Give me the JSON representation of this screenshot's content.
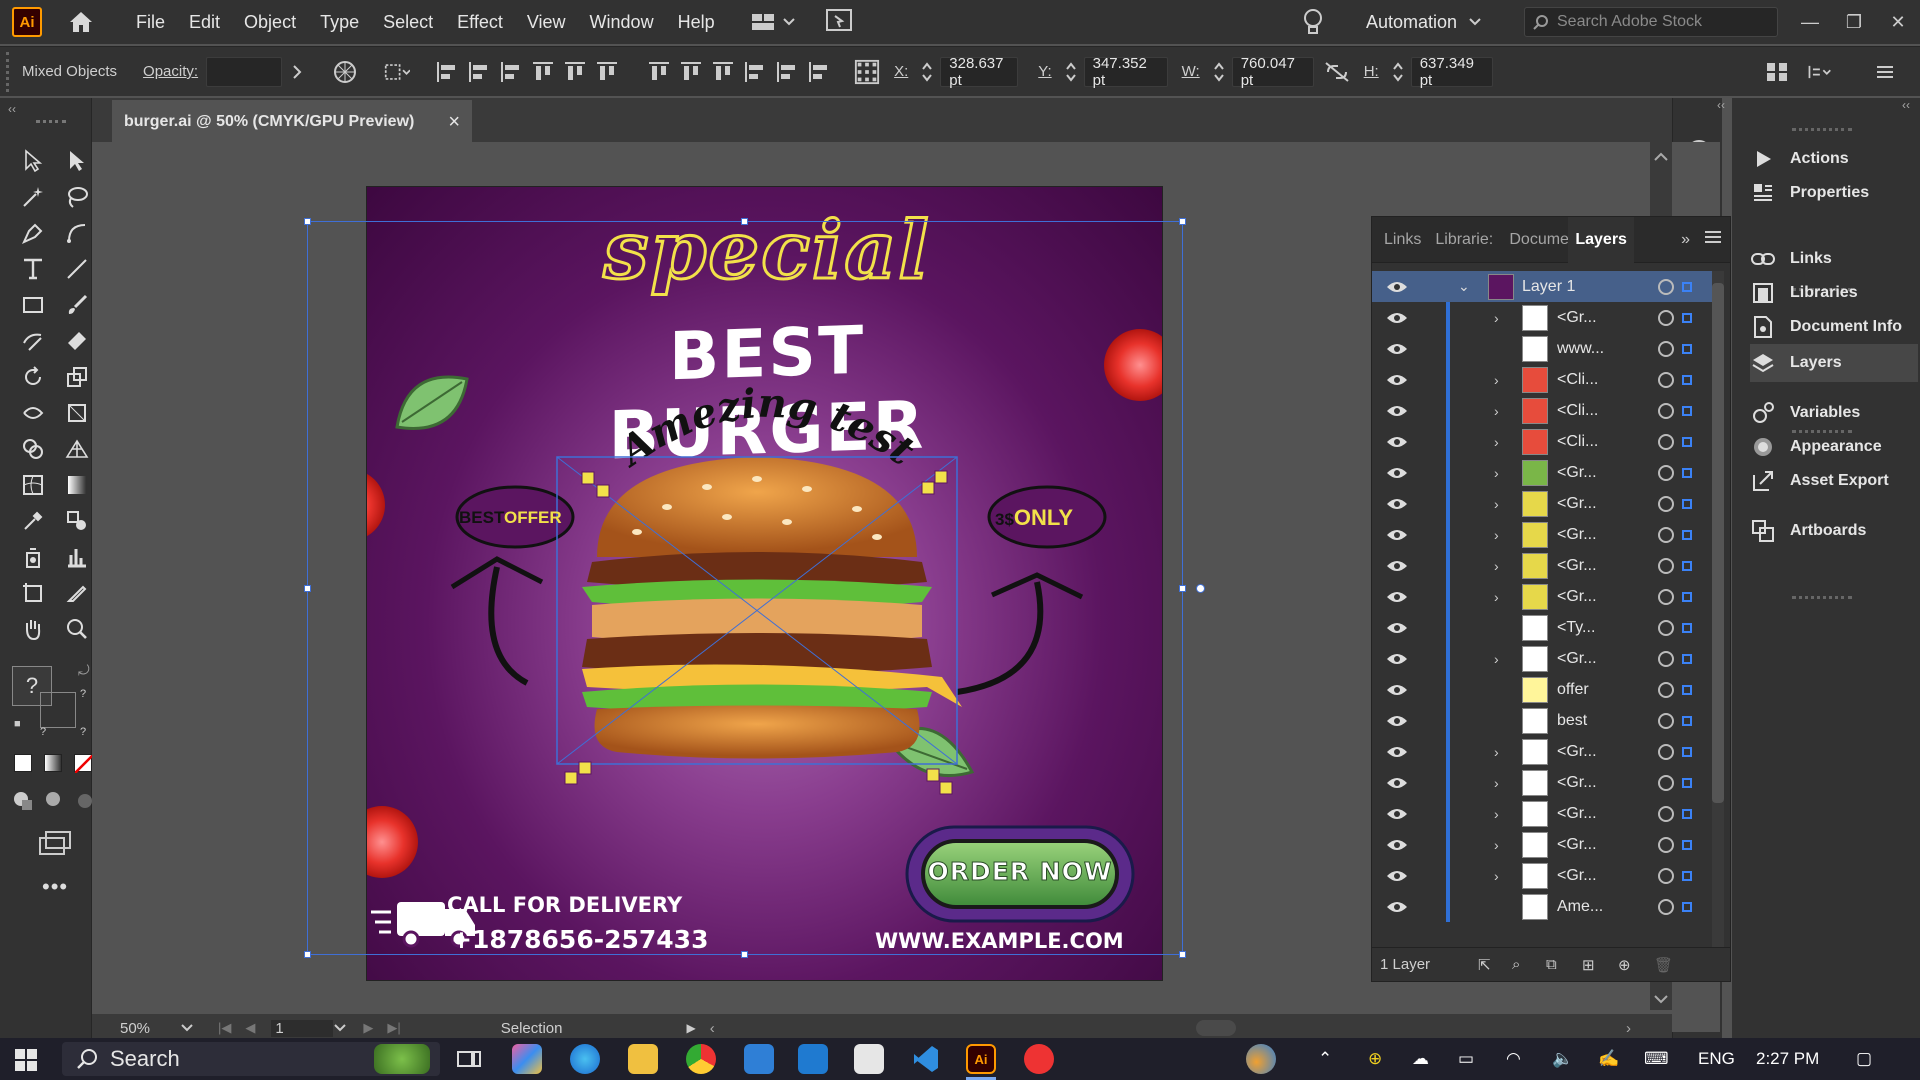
{
  "app": {
    "logo": "Ai"
  },
  "menu": [
    "File",
    "Edit",
    "Object",
    "Type",
    "Select",
    "Effect",
    "View",
    "Window",
    "Help"
  ],
  "automation_label": "Automation",
  "search_stock_placeholder": "Search Adobe Stock",
  "controlbar": {
    "selection_type": "Mixed Objects",
    "opacity_label": "Opacity:",
    "x_label": "X:",
    "x_value": "328.637 pt",
    "y_label": "Y:",
    "y_value": "347.352 pt",
    "w_label": "W:",
    "w_value": "760.047 pt",
    "h_label": "H:",
    "h_value": "637.349 pt"
  },
  "document_tab": {
    "title": "burger.ai @ 50% (CMYK/GPU Preview)",
    "close": "×"
  },
  "artboard": {
    "headline_script": "special",
    "headline_main": "BEST BURGER",
    "tagline": "Amezing test",
    "left_bubble_a": "BEST",
    "left_bubble_b": "OFFER",
    "right_bubble_a": "3$",
    "right_bubble_b": "ONLY",
    "order_button": "ORDER NOW",
    "call_label": "CALL FOR DELIVERY",
    "phone": "+1878656-257433",
    "website": "WWW.EXAMPLE.COM"
  },
  "statusbar": {
    "zoom": "50%",
    "page": "1",
    "tool": "Selection"
  },
  "layers_panel": {
    "tabs": [
      "Links",
      "Librarie:",
      "Docume",
      "Layers"
    ],
    "active_tab": "Layers",
    "layer_name": "Layer 1",
    "rows": [
      {
        "name": "<Gr...",
        "expand": true,
        "thumb": "#ffffff"
      },
      {
        "name": "www...",
        "expand": false,
        "thumb": "#ffffff"
      },
      {
        "name": "<Cli...",
        "expand": true,
        "thumb": "#e74c3c"
      },
      {
        "name": "<Cli...",
        "expand": true,
        "thumb": "#e74c3c"
      },
      {
        "name": "<Cli...",
        "expand": true,
        "thumb": "#e74c3c"
      },
      {
        "name": "<Gr...",
        "expand": true,
        "thumb": "#7ab648"
      },
      {
        "name": "<Gr...",
        "expand": true,
        "thumb": "#e6d84a"
      },
      {
        "name": "<Gr...",
        "expand": true,
        "thumb": "#e6d84a"
      },
      {
        "name": "<Gr...",
        "expand": true,
        "thumb": "#e6d84a"
      },
      {
        "name": "<Gr...",
        "expand": true,
        "thumb": "#e6d84a"
      },
      {
        "name": "<Ty...",
        "expand": false,
        "thumb": "#ffffff"
      },
      {
        "name": "<Gr...",
        "expand": true,
        "thumb": "#ffffff"
      },
      {
        "name": "offer",
        "expand": false,
        "thumb": "#fff59a"
      },
      {
        "name": "best",
        "expand": false,
        "thumb": "#ffffff"
      },
      {
        "name": "<Gr...",
        "expand": true,
        "thumb": "#ffffff"
      },
      {
        "name": "<Gr...",
        "expand": true,
        "thumb": "#ffffff"
      },
      {
        "name": "<Gr...",
        "expand": true,
        "thumb": "#ffffff"
      },
      {
        "name": "<Gr...",
        "expand": true,
        "thumb": "#ffffff"
      },
      {
        "name": "<Gr...",
        "expand": true,
        "thumb": "#ffffff"
      },
      {
        "name": "Ame...",
        "expand": false,
        "thumb": "#ffffff"
      }
    ],
    "footer_count": "1 Layer"
  },
  "dock": {
    "items": [
      "Actions",
      "Properties",
      "Links",
      "Libraries",
      "Document Info",
      "Layers",
      "Variables",
      "Appearance",
      "Asset Export",
      "Artboards"
    ],
    "active": "Layers"
  },
  "taskbar": {
    "search_label": "Search",
    "language": "ENG",
    "time": "2:27 PM"
  },
  "colors": {
    "accent": "#2f6fd6",
    "selection": "#3f6fd6",
    "brand_orange": "#ff9a00",
    "burger_purple": "#5b1560",
    "headline_yellow": "#f2e14a"
  }
}
